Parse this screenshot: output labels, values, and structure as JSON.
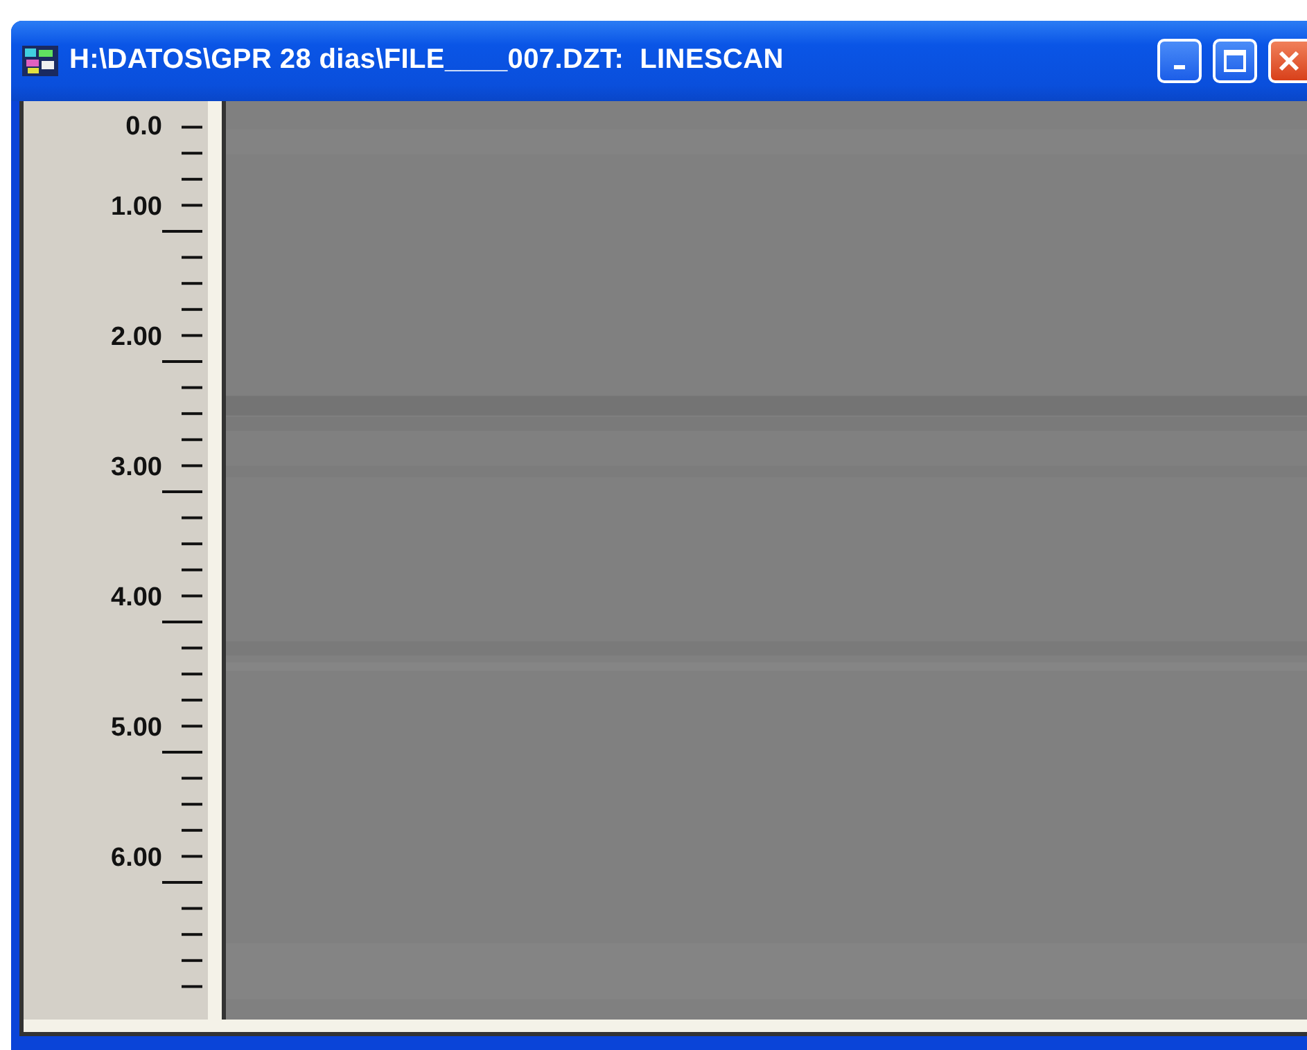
{
  "window": {
    "title": "H:\\DATOS\\GPR 28 dias\\FILE____007.DZT:  LINESCAN"
  },
  "ruler": {
    "labels": [
      "0.0",
      "1.00",
      "2.00",
      "3.00",
      "4.00",
      "5.00",
      "6.00"
    ]
  }
}
